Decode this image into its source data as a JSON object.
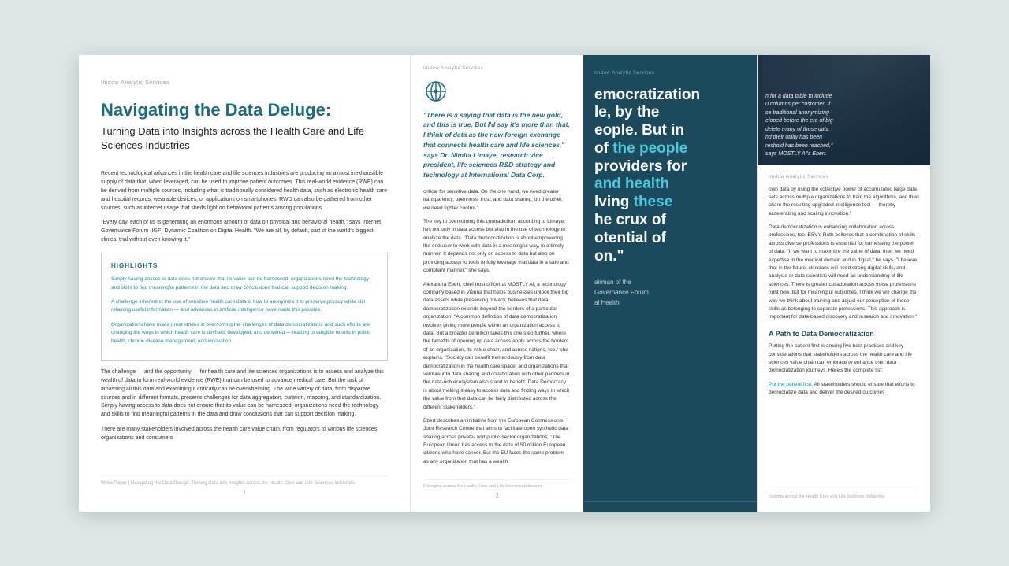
{
  "pages": [
    {
      "brand": "Imdow Analytic Services",
      "title": "Navigating the Data Deluge:",
      "subtitle": "Turning Data into Insights across the Health Care and Life Sciences Industries",
      "body_paragraphs": [
        "Recent technological advances in the health care and life sciences industries are producing an almost inexhaustible supply of data that, when leveraged, can be used to improve patient outcomes. This real-world evidence (RWE) can be derived from multiple sources, including what is traditionally considered health data, such as electronic health care and hospital records, wearable devices, or applications on smartphones. RWD can also be gathered from other sources, such as internet usage that sheds light on behavioral patterns among populations.",
        "\"Every day, each of us is generating an enormous amount of data on physical and behavioral health,\" says Internet Governance Forum (IGF) Dynamic Coalition on Digital Health. \"We are all, by default, part of the world's biggest clinical trial without even knowing it.\"",
        "The challenge — and the opportunity — for health care and life sciences organizations is to access and analyze this wealth of data to form real-world evidence (RWE) that can be used to advance medical care. But the task of amassing all this data and examining it critically can be overwhelming. The wide variety of data, from disparate sources and in different formats, presents challenges for data aggregation, curation, mapping, and standardization. Simply having access to data does not ensure that its value can be harnessed; organizations need the technology and skills to find meaningful patterns in the data and draw conclusions that can support decision making.",
        "There are many stakeholders involved across the health care value chain, from regulators to various life sciences organizations and consumers"
      ],
      "highlights": {
        "title": "HIGHLIGHTS",
        "items": [
          "Simply having access to data does not ensure that its value can be harnessed; organizations need the technology and skills to find meaningful patterns in the data and draw conclusions that can support decision making.",
          "A challenge inherent in the use of sensitive health care data is how to anonymize it to preserve privacy while still retaining useful information — and advances in artificial intelligence have made this possible.",
          "Organizations have made great strides in overcoming the challenges of data democratization, and such efforts are changing the ways in which health care is devised, developed, and delivered — leading to tangible results in public health, chronic disease management, and innovation."
        ]
      },
      "footer": "White Paper | Navigating the Data Deluge: Turning Data into Insights across the Health Care and Life Sciences Industries",
      "page_number": "1"
    },
    {
      "brand": "Imdow Analytic Services",
      "globe_icon": "⊕",
      "quote": "\"There is a saying that data is the new gold, and this is true. But I'd say it's more than that. I think of data as the new foreign exchange that connects health care and life sciences,\" says Dr. Nimita Limaye, research vice president, life sciences R&D strategy and technology at International Data Corp.",
      "body_paragraphs": [
        "critical for sensitive data. On the one hand, we need greater transparency, openness, trust, and data sharing; on the other, we need tighter control.\"",
        "The key to overcoming this contradiction, according to Limaye, lies not only in data access but also in the use of technology to analyze the data. \"Data democratization is about empowering the end user to work with data in a meaningful way, in a timely manner. It depends not only on access to data but also on providing access to tools to fully leverage that data in a safe and compliant manner,\" she says.",
        "Alexandra Ebert, chief trust officer at MOSTLY AI, a technology company based in Vienna that helps businesses unlock their big data assets while preserving privacy, believes that data democratization extends beyond the borders of a particular organization. \"A common definition of data democratization involves giving more people within an organization access to data. But a broader definition takes this one step further, where the benefits of opening up data access apply across the borders of an organization, its value chain, and across nations, too,\" she explains. \"Society can benefit tremendously from data democratization in the health care space, and organizations that venture into data sharing and collaboration with other partners in the data-rich ecosystem also stand to benefit. Data Democracy is about making it easy to access data and finding ways in which the value from that data can be fairly distributed across the different stakeholders.\"",
        "Ebert describes an initiative from the European Commission's Joint Research Centre that aims to facilitate open synthetic data sharing across private- and public-sector organizations. \"The European Union has access to the data of 50 million European citizens who have cancer. But the EU faces the same problem as any organization that has a wealth"
      ],
      "footer": "5  Insights across the Health Care and Life Sciences Industries",
      "page_number": "3"
    },
    {
      "brand": "Imdow Analytic Services",
      "big_text_lines": [
        "emocratization",
        "le, by the",
        "eople. But in",
        "of the people",
        "providers for",
        "and health",
        "lving these",
        "he crux of",
        "otential of",
        "on.\""
      ],
      "quote_attribution": "airman of the",
      "quote_attribution2": "Governance Forum",
      "quote_attribution3": "al Health",
      "page_number": ""
    },
    {
      "brand": "Imdow Analytic Services",
      "image_text": "n for a data table to include\n0 columns per customer. If\nse traditional anonymizing\neloped before the era of big\ndelete many of those data\nnd their utility has been\nreshold has been reached,\"\nsays MOSTLY AI's Ebert.",
      "body_paragraphs": [
        "own data by using the collective power of accumulated large data sets across multiple organizations to train the algorithms, and then share the resulting upgraded intelligence tool — thereby accelerating and scaling innovation.\"",
        "Data democratization is enhancing collaboration across professions, too. ESV's Rath believes that a combination of skills across diverse professions is essential for harnessing the power of data. \"If we want to maximize the value of data, then we need expertise in the medical domain and in digital,\" he says. \"I believe that in the future, clinicians will need strong digital skills, and analysts or data scientists will need an understanding of life sciences. There is greater collaboration across these professions right now, but for meaningful outcomes, I think we will change the way we think about training and adjust our perception of these skills as belonging to separate professions. This approach is important for data-based discovery and research and innovation.\""
      ],
      "section_title": "A Path to Data Democratization",
      "section_body": "Putting the patient first is among five best practices and key considerations that stakeholders across the health care and life sciences value chain can embrace to enhance their data democratization journeys. Here's the complete list:",
      "link_text": "Put the patient first.",
      "link_body": "All stakeholders should ensure that efforts to democratize data and deliver the desired outcomes",
      "footer": "Insights across the Health Care and Life Sciences Industries",
      "page_number": ""
    }
  ]
}
